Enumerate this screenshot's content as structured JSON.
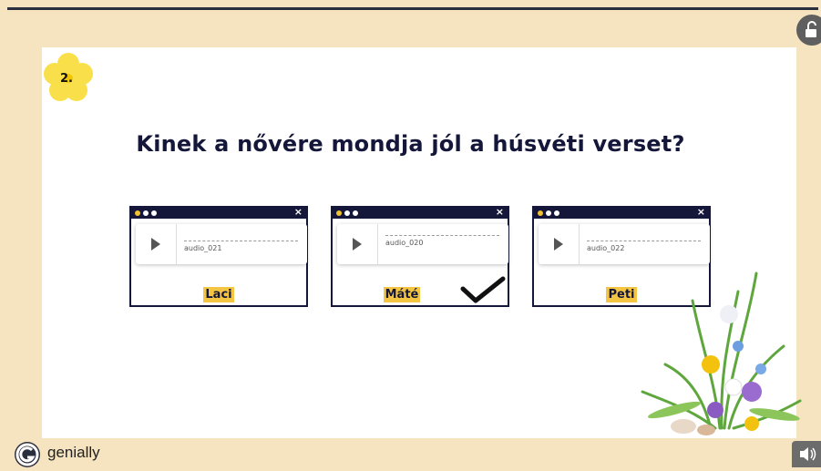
{
  "slide": {
    "number": "2.",
    "question": "Kinek a nővére mondja jól a húsvéti verset?"
  },
  "cards": [
    {
      "audio": "audio_021",
      "name": "Laci",
      "close": "×",
      "checked": false
    },
    {
      "audio": "audio_020",
      "name": "Máté",
      "close": "×",
      "checked": true
    },
    {
      "audio": "audio_022",
      "name": "Peti",
      "close": "×",
      "checked": false
    }
  ],
  "footer": {
    "brand": "genially"
  },
  "icons": {
    "flower": "flower-icon",
    "play": "play-icon",
    "check": "checkmark-icon",
    "lock": "unlock-icon",
    "sound": "speaker-icon",
    "logo": "genially-logo-icon"
  },
  "colors": {
    "background": "#f6e3bf",
    "navy": "#14163a",
    "highlight": "#f4c542",
    "flower": "#f9e04a"
  }
}
